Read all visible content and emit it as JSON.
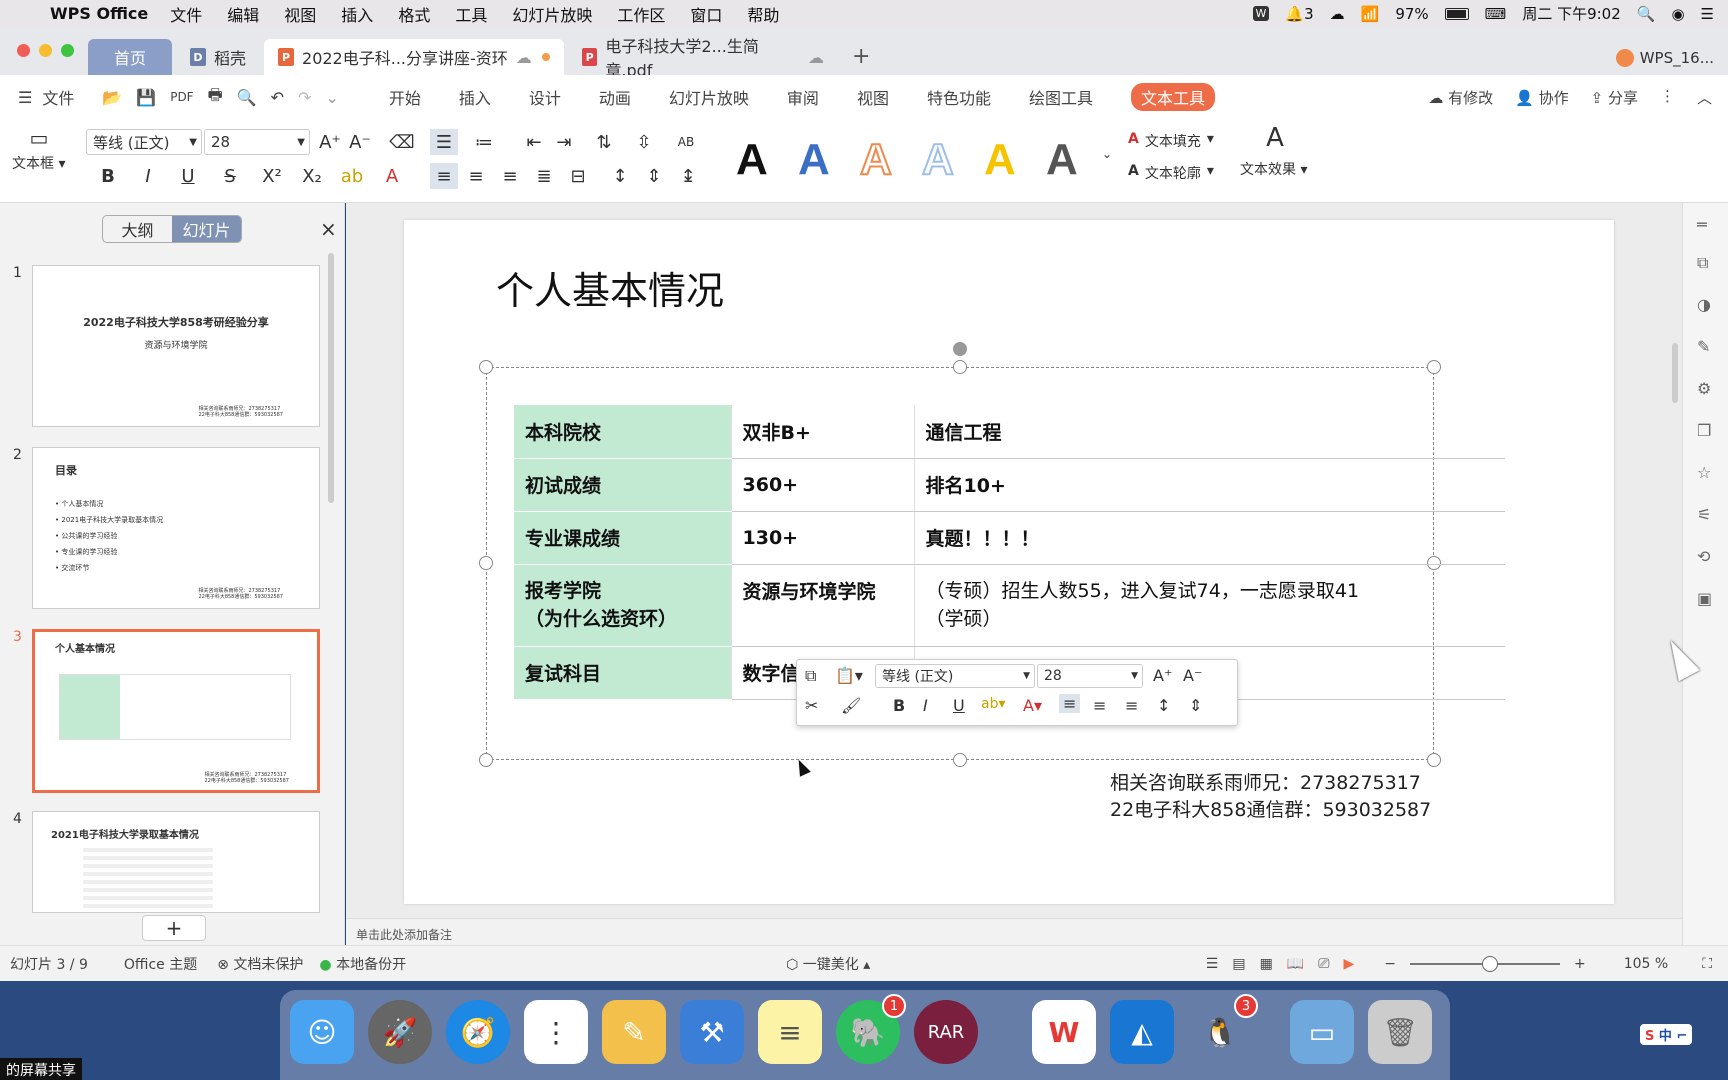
{
  "menubar": {
    "app_name": "WPS Office",
    "items": [
      "文件",
      "编辑",
      "视图",
      "插入",
      "格式",
      "工具",
      "幻灯片放映",
      "工作区",
      "窗口",
      "帮助"
    ],
    "notif_count": "3",
    "battery": "97%",
    "datetime": "周二 下午9:02"
  },
  "tabs": {
    "home": "首页",
    "daoke": "稻壳",
    "active_doc": "2022电子科...分享讲座-资环",
    "pdf_doc": "电子科技大学2...生简章.pdf",
    "plus": "+",
    "user": "WPS_16..."
  },
  "ribbon_nav": {
    "file": "文件",
    "items": [
      "开始",
      "插入",
      "设计",
      "动画",
      "幻灯片放映",
      "审阅",
      "视图",
      "特色功能",
      "绘图工具"
    ],
    "active": "文本工具",
    "modified": "有修改",
    "collab": "协作",
    "share": "分享"
  },
  "ribbon": {
    "textbox_label": "文本框",
    "font_name": "等线 (正文)",
    "font_size": "28",
    "text_fill": "文本填充",
    "text_outline": "文本轮廓",
    "text_effect": "文本效果",
    "styles": [
      {
        "glyph": "A",
        "color": "#111111"
      },
      {
        "glyph": "A",
        "color": "#3a6fc4"
      },
      {
        "glyph": "A",
        "color": "#f08a4b"
      },
      {
        "glyph": "A",
        "color": "#9dbfe8"
      },
      {
        "glyph": "A",
        "color": "#f5c400"
      },
      {
        "glyph": "A",
        "color": "#555555"
      }
    ]
  },
  "left_panel": {
    "tab_outline": "大纲",
    "tab_slides": "幻灯片",
    "close": "×",
    "add": "+",
    "slides": [
      {
        "num": "1",
        "title": "2022电子科技大学858考研经验分享",
        "subtitle": "资源与环境学院",
        "footer": "相关咨询联系雨师兄：2738275317\n22电子科大858通信群：593032587"
      },
      {
        "num": "2",
        "title": "目录",
        "items": [
          "个人基本情况",
          "2021电子科技大学录取基本情况",
          "公共课的学习经验",
          "专业课的学习经验",
          "交流环节"
        ],
        "footer": "相关咨询联系雨师兄：2738275317\n22电子科大858通信群：593032587"
      },
      {
        "num": "3",
        "title": "个人基本情况",
        "footer": "相关咨询联系雨师兄：2738275317\n22电子科大858通信群：593032587"
      },
      {
        "num": "4",
        "title": "2021电子科技大学录取基本情况"
      }
    ]
  },
  "slide": {
    "title": "个人基本情况",
    "rows": [
      {
        "label": "本科院校",
        "value": "双非B+",
        "detail": "通信工程"
      },
      {
        "label": "初试成绩",
        "value": "360+",
        "detail": "排名10+"
      },
      {
        "label": "专业课成绩",
        "value": "130+",
        "detail": "真题！！！！"
      },
      {
        "label": "报考学院\n（为什么选资环）",
        "value": "资源与环境学院",
        "detail": "（专硕）招生人数55，进入复试74，一志愿录取41\n（学硕）"
      },
      {
        "label": "复试科目",
        "value": "数字信",
        "detail": ""
      }
    ],
    "contact1": "相关咨询联系雨师兄：2738275317",
    "contact2": "22电子科大858通信群：593032587"
  },
  "float_toolbar": {
    "font_name": "等线 (正文)",
    "font_size": "28"
  },
  "notes_placeholder": "单击此处添加备注",
  "status": {
    "slide_info": "幻灯片 3 / 9",
    "theme": "Office 主题",
    "protect": "文档未保护",
    "backup": "本地备份开",
    "beautify": "一键美化",
    "zoom": "105 %"
  },
  "dock": {
    "badge_evernote": "1",
    "badge_qq": "3"
  },
  "screen_share": "的屏幕共享"
}
